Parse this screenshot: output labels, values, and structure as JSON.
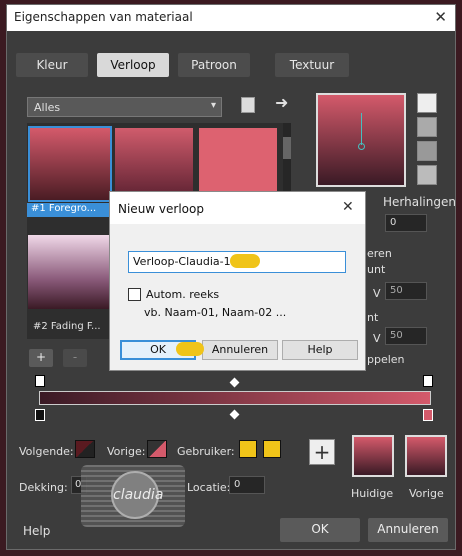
{
  "window": {
    "title": "Eigenschappen van materiaal",
    "close": "✕"
  },
  "tabs": [
    "Kleur",
    "Verloop",
    "Patroon",
    "Textuur"
  ],
  "category": {
    "value": "Alles"
  },
  "gradients": [
    {
      "label": "#1 Foregro..."
    },
    {
      "label": "#2 Fading F..."
    }
  ],
  "right": {
    "repetitions_label": "Herhalingen",
    "repetitions_value": "0",
    "fragments": [
      "eren",
      "unt",
      "nt",
      "ppelen"
    ],
    "v": "V",
    "fifty": "50"
  },
  "dialog": {
    "title": "Nieuw verloop",
    "close": "✕",
    "name_value": "Verloop-Claudia-1",
    "checkbox_label": "Autom. reeks",
    "example": "vb. Naam-01, Naam-02 ...",
    "ok": "OK",
    "cancel": "Annuleren",
    "help": "Help"
  },
  "bottom": {
    "next_label": "Volgende:",
    "prev_label": "Vorige:",
    "user_label": "Gebruiker:",
    "opacity_label": "Dekking:",
    "location_label": "Locatie:",
    "location_value": "0",
    "opacity_value": "0",
    "current_label": "Huidige",
    "previous_label": "Vorige",
    "help": "Help",
    "ok": "OK",
    "cancel": "Annuleren",
    "plus": "+",
    "minus": "-",
    "logo": "claudia"
  },
  "colors": {
    "accent": "#c8505f",
    "dark": "#3b1a21",
    "gold": "#f0c419"
  }
}
